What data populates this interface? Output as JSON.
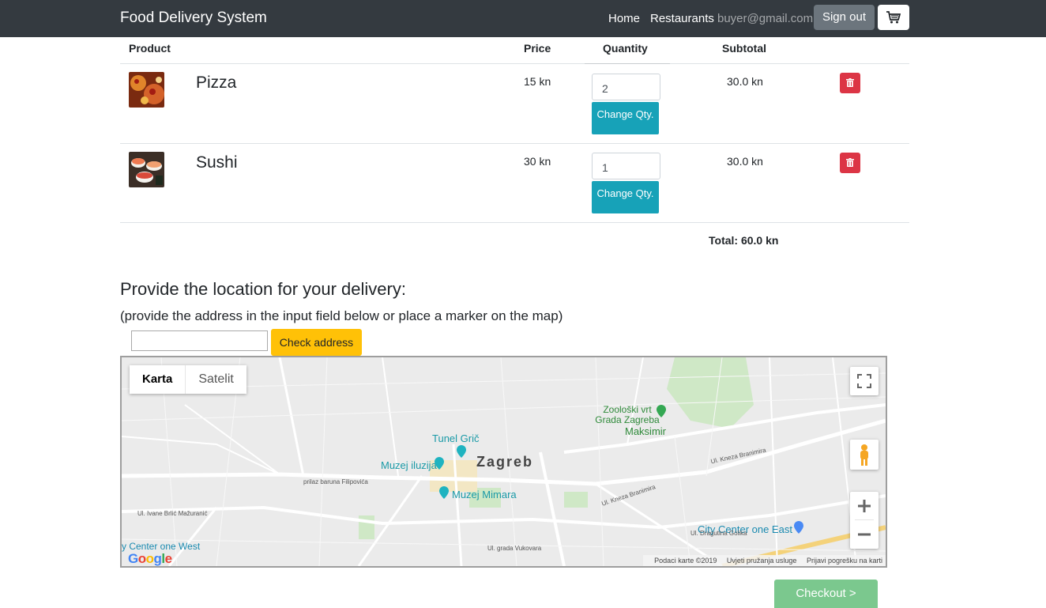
{
  "navbar": {
    "brand": "Food Delivery System",
    "links": [
      {
        "label": "Home"
      },
      {
        "label": "Restaurants"
      }
    ],
    "user_email": "buyer@gmail.com",
    "sign_out": "Sign out",
    "cart_icon": "shopping-cart-icon"
  },
  "cart_table": {
    "headers": [
      "Product",
      "Price",
      "Quantity",
      "Subtotal"
    ],
    "rows": [
      {
        "name": "Pizza",
        "price": "15 kn",
        "quantity": "2",
        "change_label": "Change Qty.",
        "subtotal": "30.0 kn",
        "thumb": "pizza"
      },
      {
        "name": "Sushi",
        "price": "30 kn",
        "quantity": "1",
        "change_label": "Change Qty.",
        "subtotal": "30.0 kn",
        "thumb": "sushi"
      }
    ],
    "total": "Total: 60.0 kn",
    "delete_icon": "trash-icon"
  },
  "location": {
    "title": "Provide the location for your delivery:",
    "subtitle": "(provide the address in the input field below or place a marker on the map)",
    "address_value": "",
    "check_button": "Check address"
  },
  "map": {
    "type_tabs": [
      "Karta",
      "Satelit"
    ],
    "city_label": "Zagreb",
    "places": [
      "Tunel Grič",
      "Muzej iluzija",
      "Muzej Mimara",
      "Zoološki vrt Grada Zagreba",
      "Maksimir",
      "City Center one East",
      "y Center one West"
    ],
    "streets": [
      "prilaz baruna Filipovića",
      "Ul. Ivane Brlić Mažuranić",
      "Ul. Kneza Branimira",
      "Ul. grada Vukovara",
      "Ul. Dragutina Golika",
      "Ul. Kneza Branimira"
    ],
    "footer": [
      "Podaci karte ©2019",
      "Uvjeti pružanja usluge",
      "Prijavi pogrešku na karti"
    ],
    "logo": "Google"
  },
  "checkout": "Checkout >"
}
